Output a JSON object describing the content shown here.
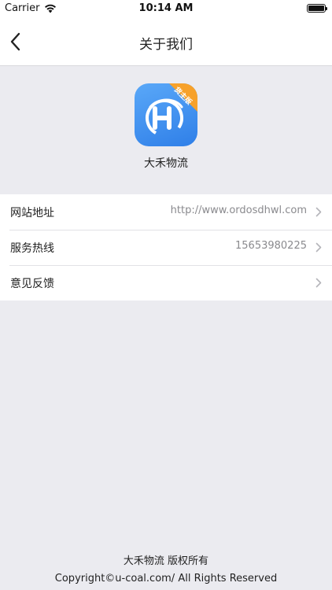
{
  "status_bar": {
    "carrier": "Carrier",
    "time": "10:14 AM",
    "wifi_icon": "wifi-icon",
    "battery_icon": "battery-icon",
    "battery_level": 1.0
  },
  "nav": {
    "title": "关于我们",
    "back_icon": "chevron-left-icon"
  },
  "app": {
    "name": "大禾物流",
    "badge": "货主版",
    "brand_color": "#3b8cf0",
    "badge_color": "#f7a12a"
  },
  "list": {
    "items": [
      {
        "label": "网站地址",
        "value": "http://www.ordosdhwl.com"
      },
      {
        "label": "服务热线",
        "value": "15653980225"
      },
      {
        "label": "意见反馈",
        "value": ""
      }
    ]
  },
  "footer": {
    "line1": "大禾物流 版权所有",
    "line2": "Copyright©u-coal.com/ All Rights Reserved"
  }
}
